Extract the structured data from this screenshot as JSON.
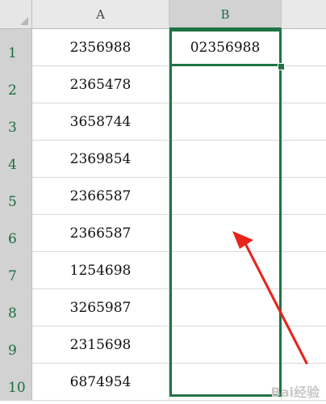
{
  "columns": [
    "A",
    "B"
  ],
  "rows": [
    {
      "num": "1",
      "a": "2356988",
      "b": "02356988"
    },
    {
      "num": "2",
      "a": "2365478",
      "b": ""
    },
    {
      "num": "3",
      "a": "3658744",
      "b": ""
    },
    {
      "num": "4",
      "a": "2369854",
      "b": ""
    },
    {
      "num": "5",
      "a": "2366587",
      "b": ""
    },
    {
      "num": "6",
      "a": "2366587",
      "b": ""
    },
    {
      "num": "7",
      "a": "1254698",
      "b": ""
    },
    {
      "num": "8",
      "a": "3265987",
      "b": ""
    },
    {
      "num": "9",
      "a": "2315698",
      "b": ""
    },
    {
      "num": "10",
      "a": "6874954",
      "b": ""
    }
  ],
  "colors": {
    "selection": "#217346",
    "header_bg": "#e9e9e9",
    "arrow": "#e8231a"
  },
  "watermark": "Bai经验"
}
